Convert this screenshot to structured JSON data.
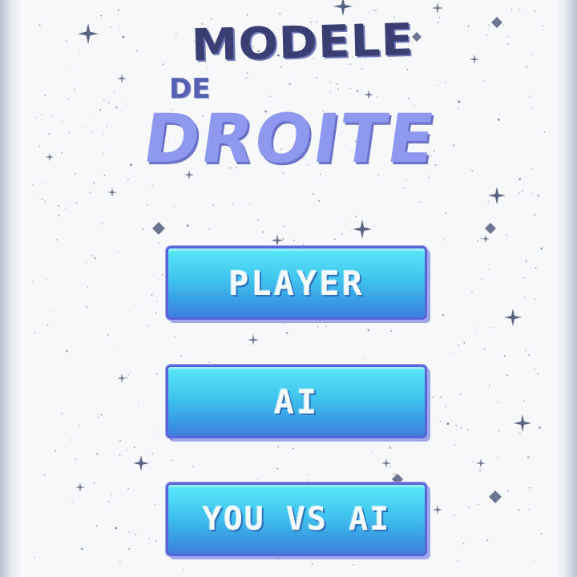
{
  "title": {
    "line1": "MODELE",
    "line2": "DE",
    "line3": "DROITE"
  },
  "menu": {
    "buttons": [
      {
        "label": "PLAYER"
      },
      {
        "label": "AI"
      },
      {
        "label": "YOU VS AI"
      }
    ]
  },
  "colors": {
    "title_dark": "#3a3f73",
    "title_light": "#8e98ee",
    "button_top": "#59e8f9",
    "button_bottom": "#3d80dd",
    "button_border": "#5a63d8",
    "star": "#3d4a6e"
  },
  "icons": {
    "star": "sparkle-star-icon"
  }
}
